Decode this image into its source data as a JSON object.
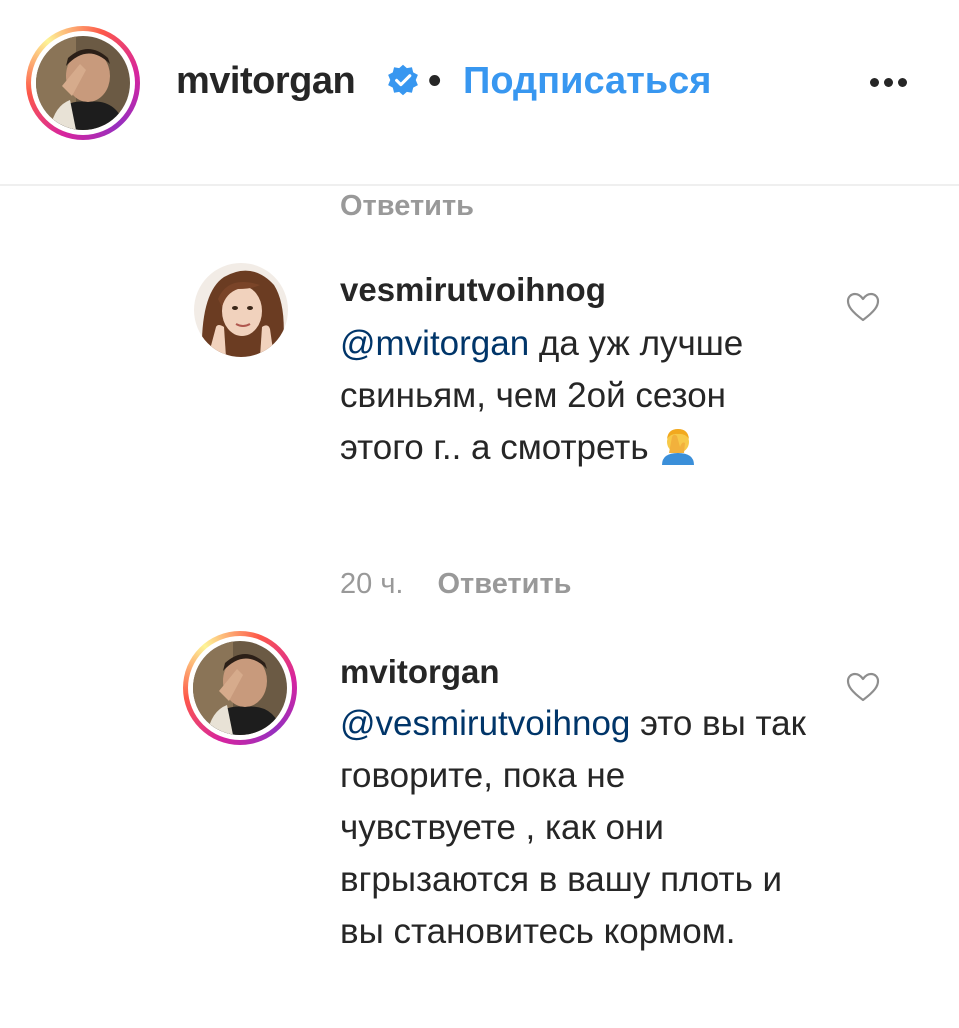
{
  "header": {
    "username": "mvitorgan",
    "separator": "•",
    "follow_label": "Подписаться",
    "verified_icon": "verified-badge-icon",
    "more_icon": "more-options-icon"
  },
  "thread": {
    "reply_label_top": "Ответить"
  },
  "comments": [
    {
      "username": "vesmirutvoihnog",
      "mention": "@mvitorgan",
      "text": " да уж лучше свиньям, чем 2ой сезон этого г.. а смотреть ",
      "emoji": "face-palm-emoji",
      "time": "20 ч.",
      "reply_label": "Ответить"
    },
    {
      "username": "mvitorgan",
      "mention": "@vesmirutvoihnog",
      "text": " это вы так говорите, пока не чувствуете , как они вгрызаются в вашу плоть и вы становитесь кормом."
    }
  ],
  "colors": {
    "link_blue": "#3897f0",
    "mention_navy": "#003569",
    "meta_gray": "#999999",
    "text_dark": "#262626"
  }
}
